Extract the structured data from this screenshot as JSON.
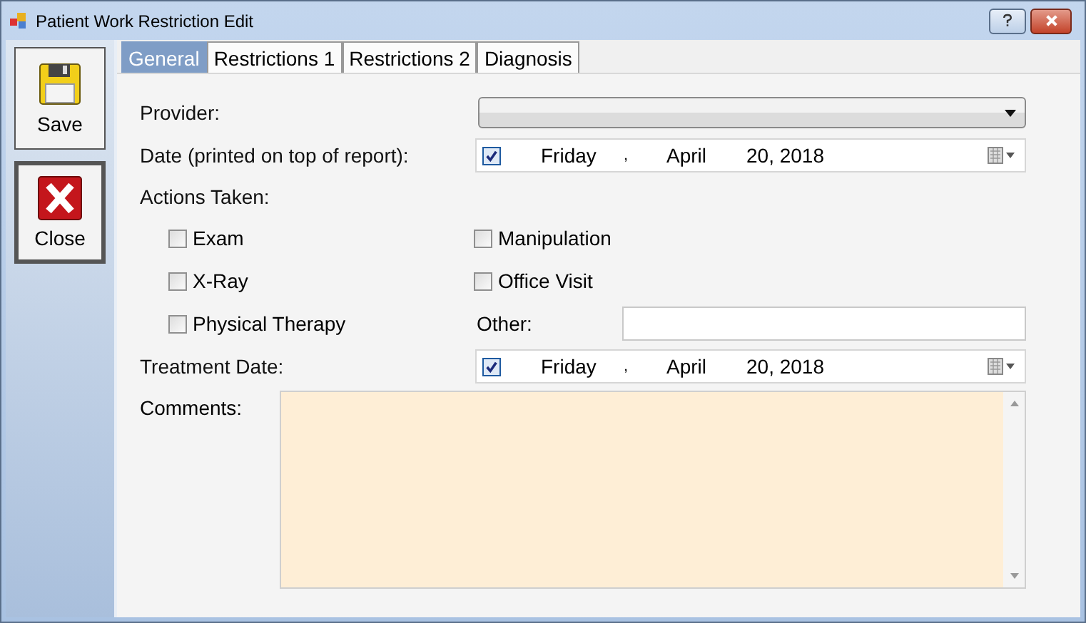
{
  "window": {
    "title": "Patient Work Restriction Edit"
  },
  "sidebar": {
    "buttons": [
      {
        "kind": "save",
        "label": "Save",
        "selected": false
      },
      {
        "kind": "close",
        "label": "Close",
        "selected": true
      }
    ]
  },
  "tabs": [
    {
      "label": "General",
      "selected": true
    },
    {
      "label": "Restrictions 1",
      "selected": false
    },
    {
      "label": "Restrictions 2",
      "selected": false
    },
    {
      "label": "Diagnosis",
      "selected": false
    }
  ],
  "form": {
    "provider_label": "Provider:",
    "report_date": {
      "label": "Date (printed on top of report):",
      "checked": true,
      "weekday": "Friday",
      "separator": ",",
      "month": "April",
      "day_year": "20, 2018"
    },
    "actions_label": "Actions Taken:",
    "actions": [
      {
        "label": "Exam",
        "checked": false
      },
      {
        "label": "Manipulation",
        "checked": false
      },
      {
        "label": "X-Ray",
        "checked": false
      },
      {
        "label": "Office Visit",
        "checked": false
      },
      {
        "label": "Physical Therapy",
        "checked": false
      }
    ],
    "other_label": "Other:",
    "treatment_date": {
      "label": "Treatment Date:",
      "checked": true,
      "weekday": "Friday",
      "separator": ",",
      "month": "April",
      "day_year": "20, 2018"
    },
    "comments_label": "Comments:"
  }
}
